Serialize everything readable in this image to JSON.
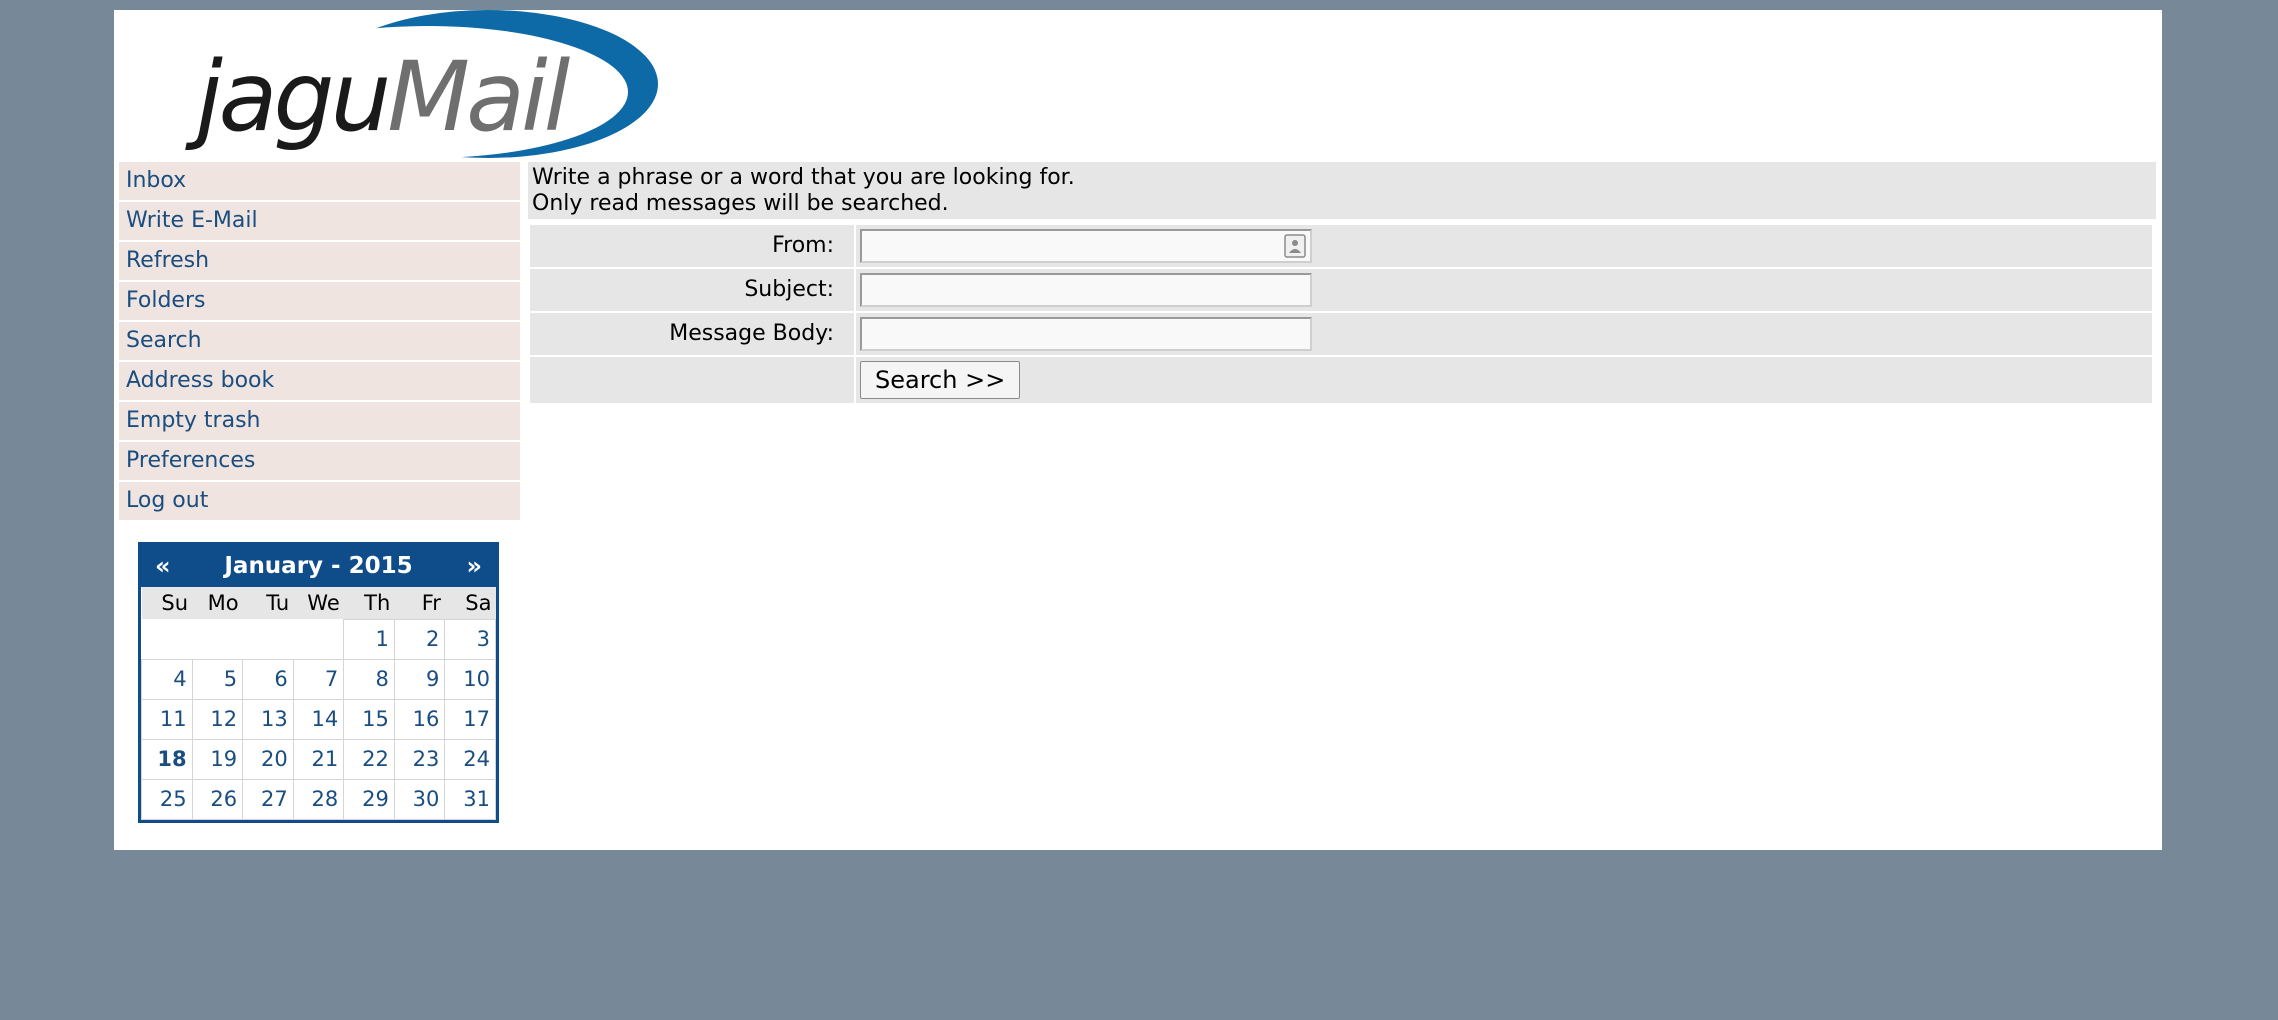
{
  "logo": {
    "text_dark": "jagu",
    "text_light": "Mail",
    "brand_color": "#0e6aa6"
  },
  "menu": {
    "items": [
      {
        "label": "Inbox"
      },
      {
        "label": "Write E-Mail"
      },
      {
        "label": "Refresh"
      },
      {
        "label": "Folders"
      },
      {
        "label": "Search"
      },
      {
        "label": "Address book"
      },
      {
        "label": "Empty trash"
      },
      {
        "label": "Preferences"
      },
      {
        "label": "Log out"
      }
    ]
  },
  "calendar": {
    "prev": "«",
    "title": "January - 2015",
    "next": "»",
    "weekdays": [
      "Su",
      "Mo",
      "Tu",
      "We",
      "Th",
      "Fr",
      "Sa"
    ],
    "weeks": [
      [
        "",
        "",
        "",
        "",
        "1",
        "2",
        "3"
      ],
      [
        "4",
        "5",
        "6",
        "7",
        "8",
        "9",
        "10"
      ],
      [
        "11",
        "12",
        "13",
        "14",
        "15",
        "16",
        "17"
      ],
      [
        "18",
        "19",
        "20",
        "21",
        "22",
        "23",
        "24"
      ],
      [
        "25",
        "26",
        "27",
        "28",
        "29",
        "30",
        "31"
      ]
    ],
    "today": "18",
    "accent_color": "#0f4d8a"
  },
  "search": {
    "intro_line1": "Write a phrase or a word that you are looking for.",
    "intro_line2": "Only read messages will be searched.",
    "from_label": "From:",
    "from_value": "",
    "subject_label": "Subject:",
    "subject_value": "",
    "body_label": "Message Body:",
    "body_value": "",
    "button_label": "Search >>",
    "contact_icon": "address-book-icon"
  }
}
